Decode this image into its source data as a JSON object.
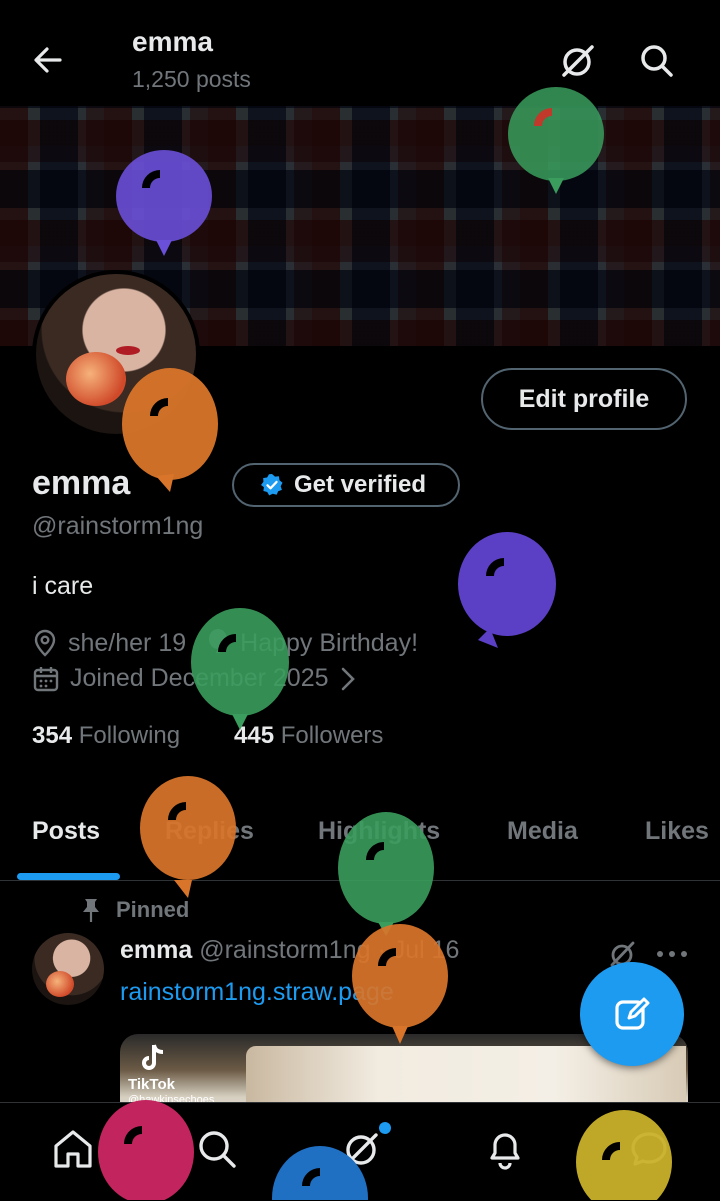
{
  "header": {
    "title": "emma",
    "post_count": "1,250 posts"
  },
  "profile": {
    "edit_label": "Edit profile",
    "display_name": "emma",
    "verify_label": "Get verified",
    "handle": "@rainstorm1ng",
    "bio": "i care",
    "location": "she/her 19",
    "birthday": "Happy Birthday!",
    "joined": "Joined December 2025",
    "following_count": "354",
    "following_label": "Following",
    "followers_count": "445",
    "followers_label": "Followers"
  },
  "tabs": [
    {
      "label": "Posts",
      "active": true
    },
    {
      "label": "Replies"
    },
    {
      "label": "Highlights"
    },
    {
      "label": "Media"
    },
    {
      "label": "Likes"
    }
  ],
  "post": {
    "pinned_label": "Pinned",
    "author_name": "emma",
    "author_handle": "@rainstorm1ng",
    "separator": "·",
    "date": "Jul 16",
    "link": "rainstorm1ng.straw.page",
    "media_brand": "TikTok",
    "media_handle": "@hawkinsechoes"
  },
  "colors": {
    "accent": "#1d9bf0",
    "balloon_purple": "#6a4fd8",
    "balloon_green": "#3a9d5d",
    "balloon_orange": "#d9752a",
    "balloon_pink": "#c2245e",
    "balloon_blue": "#1f6fc2",
    "balloon_yellow": "#c9b12a"
  },
  "icons": {
    "back": "arrow-left-icon",
    "grok": "grok-icon",
    "search": "search-icon",
    "location": "location-pin-icon",
    "birthday": "balloon-icon",
    "calendar": "calendar-icon",
    "pin": "pin-icon",
    "compose": "compose-icon",
    "nav": [
      "home-icon",
      "search-icon",
      "grok-icon",
      "bell-icon",
      "messages-icon"
    ]
  }
}
